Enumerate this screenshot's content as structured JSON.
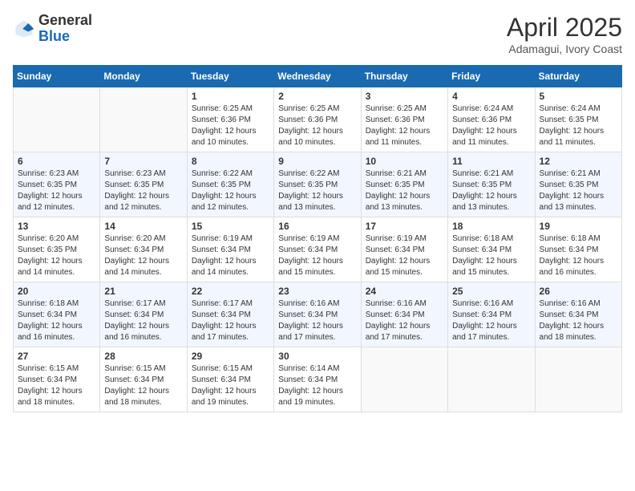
{
  "header": {
    "logo_general": "General",
    "logo_blue": "Blue",
    "month_year": "April 2025",
    "location": "Adamagui, Ivory Coast"
  },
  "days_of_week": [
    "Sunday",
    "Monday",
    "Tuesday",
    "Wednesday",
    "Thursday",
    "Friday",
    "Saturday"
  ],
  "weeks": [
    [
      {
        "day": "",
        "info": ""
      },
      {
        "day": "",
        "info": ""
      },
      {
        "day": "1",
        "info": "Sunrise: 6:25 AM\nSunset: 6:36 PM\nDaylight: 12 hours and 10 minutes."
      },
      {
        "day": "2",
        "info": "Sunrise: 6:25 AM\nSunset: 6:36 PM\nDaylight: 12 hours and 10 minutes."
      },
      {
        "day": "3",
        "info": "Sunrise: 6:25 AM\nSunset: 6:36 PM\nDaylight: 12 hours and 11 minutes."
      },
      {
        "day": "4",
        "info": "Sunrise: 6:24 AM\nSunset: 6:36 PM\nDaylight: 12 hours and 11 minutes."
      },
      {
        "day": "5",
        "info": "Sunrise: 6:24 AM\nSunset: 6:35 PM\nDaylight: 12 hours and 11 minutes."
      }
    ],
    [
      {
        "day": "6",
        "info": "Sunrise: 6:23 AM\nSunset: 6:35 PM\nDaylight: 12 hours and 12 minutes."
      },
      {
        "day": "7",
        "info": "Sunrise: 6:23 AM\nSunset: 6:35 PM\nDaylight: 12 hours and 12 minutes."
      },
      {
        "day": "8",
        "info": "Sunrise: 6:22 AM\nSunset: 6:35 PM\nDaylight: 12 hours and 12 minutes."
      },
      {
        "day": "9",
        "info": "Sunrise: 6:22 AM\nSunset: 6:35 PM\nDaylight: 12 hours and 13 minutes."
      },
      {
        "day": "10",
        "info": "Sunrise: 6:21 AM\nSunset: 6:35 PM\nDaylight: 12 hours and 13 minutes."
      },
      {
        "day": "11",
        "info": "Sunrise: 6:21 AM\nSunset: 6:35 PM\nDaylight: 12 hours and 13 minutes."
      },
      {
        "day": "12",
        "info": "Sunrise: 6:21 AM\nSunset: 6:35 PM\nDaylight: 12 hours and 13 minutes."
      }
    ],
    [
      {
        "day": "13",
        "info": "Sunrise: 6:20 AM\nSunset: 6:35 PM\nDaylight: 12 hours and 14 minutes."
      },
      {
        "day": "14",
        "info": "Sunrise: 6:20 AM\nSunset: 6:34 PM\nDaylight: 12 hours and 14 minutes."
      },
      {
        "day": "15",
        "info": "Sunrise: 6:19 AM\nSunset: 6:34 PM\nDaylight: 12 hours and 14 minutes."
      },
      {
        "day": "16",
        "info": "Sunrise: 6:19 AM\nSunset: 6:34 PM\nDaylight: 12 hours and 15 minutes."
      },
      {
        "day": "17",
        "info": "Sunrise: 6:19 AM\nSunset: 6:34 PM\nDaylight: 12 hours and 15 minutes."
      },
      {
        "day": "18",
        "info": "Sunrise: 6:18 AM\nSunset: 6:34 PM\nDaylight: 12 hours and 15 minutes."
      },
      {
        "day": "19",
        "info": "Sunrise: 6:18 AM\nSunset: 6:34 PM\nDaylight: 12 hours and 16 minutes."
      }
    ],
    [
      {
        "day": "20",
        "info": "Sunrise: 6:18 AM\nSunset: 6:34 PM\nDaylight: 12 hours and 16 minutes."
      },
      {
        "day": "21",
        "info": "Sunrise: 6:17 AM\nSunset: 6:34 PM\nDaylight: 12 hours and 16 minutes."
      },
      {
        "day": "22",
        "info": "Sunrise: 6:17 AM\nSunset: 6:34 PM\nDaylight: 12 hours and 17 minutes."
      },
      {
        "day": "23",
        "info": "Sunrise: 6:16 AM\nSunset: 6:34 PM\nDaylight: 12 hours and 17 minutes."
      },
      {
        "day": "24",
        "info": "Sunrise: 6:16 AM\nSunset: 6:34 PM\nDaylight: 12 hours and 17 minutes."
      },
      {
        "day": "25",
        "info": "Sunrise: 6:16 AM\nSunset: 6:34 PM\nDaylight: 12 hours and 17 minutes."
      },
      {
        "day": "26",
        "info": "Sunrise: 6:16 AM\nSunset: 6:34 PM\nDaylight: 12 hours and 18 minutes."
      }
    ],
    [
      {
        "day": "27",
        "info": "Sunrise: 6:15 AM\nSunset: 6:34 PM\nDaylight: 12 hours and 18 minutes."
      },
      {
        "day": "28",
        "info": "Sunrise: 6:15 AM\nSunset: 6:34 PM\nDaylight: 12 hours and 18 minutes."
      },
      {
        "day": "29",
        "info": "Sunrise: 6:15 AM\nSunset: 6:34 PM\nDaylight: 12 hours and 19 minutes."
      },
      {
        "day": "30",
        "info": "Sunrise: 6:14 AM\nSunset: 6:34 PM\nDaylight: 12 hours and 19 minutes."
      },
      {
        "day": "",
        "info": ""
      },
      {
        "day": "",
        "info": ""
      },
      {
        "day": "",
        "info": ""
      }
    ]
  ]
}
